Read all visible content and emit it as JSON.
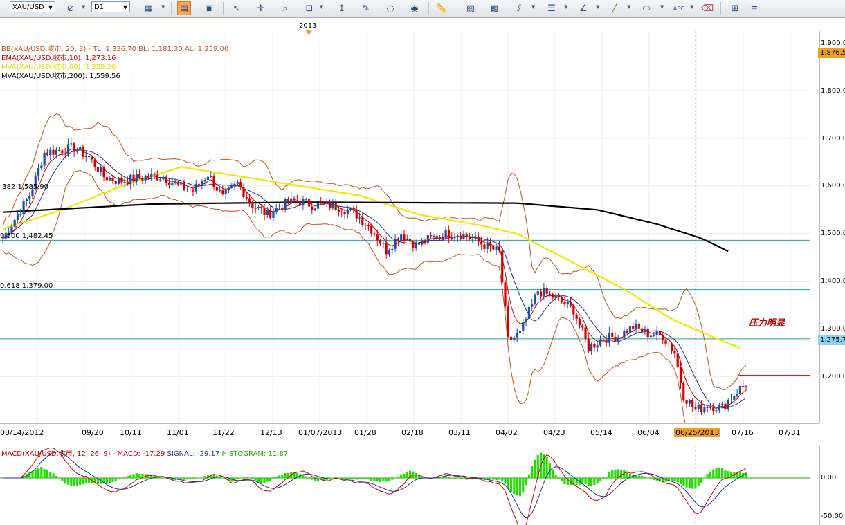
{
  "toolbar": {
    "symbol": "XAU/USD",
    "timeframe": "D1",
    "icons": [
      "link-icon",
      "chart-type-icon",
      "bar-chart-icon",
      "indicator-icon",
      "cursor-icon",
      "crosshair-icon",
      "zoom-icon",
      "zoom-fit-icon",
      "trend-line-icon",
      "annotation-icon",
      "magnet-icon",
      "globe-icon",
      "ruler-icon",
      "image-icon",
      "screenshot-icon",
      "draw-line-icon",
      "fibonacci-icon",
      "pen-icon",
      "line-icon",
      "ellipse-icon",
      "text-icon",
      "eraser-icon",
      "hierarchy-icon",
      "more-icon"
    ]
  },
  "year_label": "2013",
  "price_legend": {
    "bb": "BB(XAU/USD.收市, 20, 3) - TL: 1,336.70 BL: 1,181.30 AL: 1,259.00",
    "ema": "EMA(XAU/USD.收市,10): 1,273.16",
    "mva60": "MVA(XAU/USD.收市,60): 1,358.26",
    "mva200": "MVA(XAU/USD.收市,200): 1,559.56"
  },
  "fib_levels": [
    {
      "label": ".382 1,585.90",
      "price": 1585.9
    },
    {
      "label": "0.500 1,482.45",
      "price": 1482.45
    },
    {
      "label": "0.618 1,379.00",
      "price": 1379.0
    }
  ],
  "annotation": "压力明显",
  "price_axis": {
    "ticks": [
      "1,900.0",
      "1,800.0",
      "1,700.0",
      "1,600.0",
      "1,500.0",
      "1,400.0",
      "1,300.0",
      "1,200.0"
    ],
    "tag_top": "1,876.5",
    "tag_current": "1,275.7"
  },
  "date_axis": [
    "08/14/2012",
    "09/20",
    "10/11",
    "11/01",
    "11/22",
    "12/13",
    "01/07/2013",
    "01/28",
    "02/18",
    "03/11",
    "04/02",
    "04/23",
    "05/14",
    "06/04",
    "06/25/2013",
    "07/16",
    "07/31"
  ],
  "macd_legend": {
    "main": "MACD(XAU/USD.收市, 12, 26, 9) - MACD: -17.29",
    "signal": "SIGNAL: -29.17",
    "histogram": "HISTOGRAM: 11.87"
  },
  "macd_axis": [
    "0.00",
    "-50.00"
  ],
  "colors": {
    "bb": "#c8501a",
    "ema": "#cc0000",
    "mva60": "#f2e600",
    "mva200": "#000000",
    "fib": "#25a0a8",
    "bull": "#1f4fa3",
    "bear": "#d40000",
    "hist": "#22dd00",
    "macd": "#cc0000",
    "signal": "#1f2f9c",
    "resist": "#cc0000",
    "hl": "#f0a020"
  },
  "chart_data": {
    "type": "candlestick",
    "x_range": [
      "08/14/2012",
      "07/31/2013"
    ],
    "ylim": [
      1120,
      1910
    ],
    "anchors": [
      [
        0,
        1590
      ],
      [
        8,
        1630
      ],
      [
        18,
        1680
      ],
      [
        28,
        1770
      ],
      [
        38,
        1775
      ],
      [
        48,
        1780
      ],
      [
        58,
        1760
      ],
      [
        68,
        1720
      ],
      [
        78,
        1710
      ],
      [
        88,
        1715
      ],
      [
        98,
        1720
      ],
      [
        108,
        1720
      ],
      [
        118,
        1700
      ],
      [
        128,
        1690
      ],
      [
        138,
        1725
      ],
      [
        148,
        1675
      ],
      [
        158,
        1705
      ],
      [
        168,
        1660
      ],
      [
        178,
        1640
      ],
      [
        188,
        1660
      ],
      [
        198,
        1670
      ],
      [
        208,
        1660
      ],
      [
        218,
        1660
      ],
      [
        228,
        1655
      ],
      [
        238,
        1640
      ],
      [
        248,
        1610
      ],
      [
        258,
        1565
      ],
      [
        268,
        1600
      ],
      [
        278,
        1575
      ],
      [
        288,
        1590
      ],
      [
        298,
        1600
      ],
      [
        308,
        1600
      ],
      [
        318,
        1585
      ],
      [
        328,
        1570
      ],
      [
        334,
        1560
      ],
      [
        340,
        1375
      ],
      [
        348,
        1390
      ],
      [
        360,
        1480
      ],
      [
        372,
        1465
      ],
      [
        384,
        1440
      ],
      [
        394,
        1360
      ],
      [
        404,
        1380
      ],
      [
        414,
        1385
      ],
      [
        424,
        1405
      ],
      [
        434,
        1390
      ],
      [
        444,
        1385
      ],
      [
        452,
        1350
      ],
      [
        458,
        1260
      ],
      [
        466,
        1230
      ],
      [
        474,
        1240
      ],
      [
        484,
        1235
      ],
      [
        494,
        1270
      ],
      [
        500,
        1285
      ]
    ],
    "mva200": [
      [
        0,
        1645
      ],
      [
        100,
        1662
      ],
      [
        200,
        1666
      ],
      [
        346,
        1664
      ],
      [
        400,
        1650
      ],
      [
        440,
        1620
      ],
      [
        470,
        1590
      ],
      [
        490,
        1560
      ]
    ],
    "mva60": [
      [
        0,
        1610
      ],
      [
        40,
        1650
      ],
      [
        80,
        1700
      ],
      [
        120,
        1740
      ],
      [
        160,
        1720
      ],
      [
        200,
        1700
      ],
      [
        240,
        1680
      ],
      [
        280,
        1640
      ],
      [
        320,
        1618
      ],
      [
        346,
        1600
      ],
      [
        380,
        1545
      ],
      [
        420,
        1480
      ],
      [
        450,
        1420
      ],
      [
        480,
        1380
      ],
      [
        498,
        1357
      ]
    ],
    "macd_range": [
      -60,
      70
    ]
  }
}
